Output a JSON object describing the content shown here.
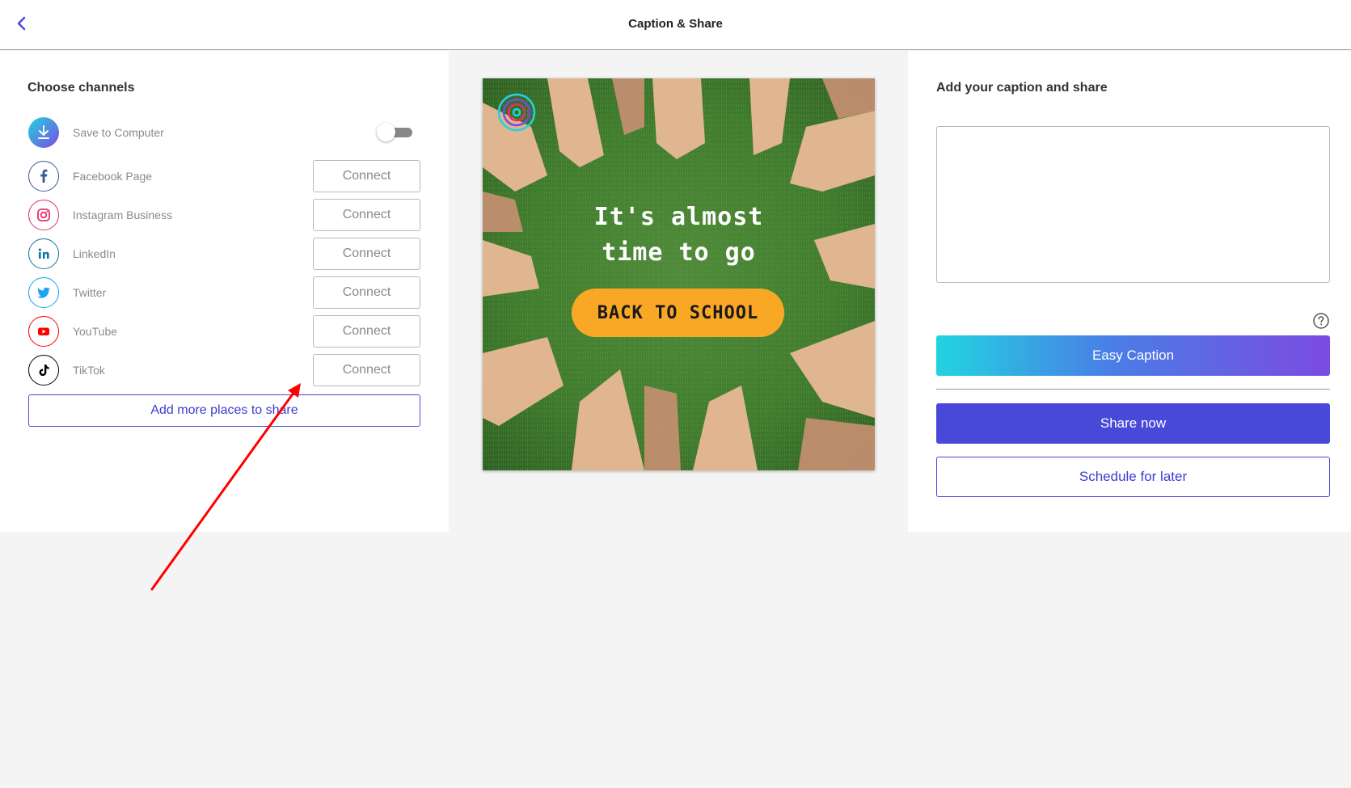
{
  "header": {
    "title": "Caption & Share",
    "back_icon": "chevron-left-icon"
  },
  "channels": {
    "title": "Choose channels",
    "items": [
      {
        "label": "Save to Computer",
        "icon": "download-icon",
        "action": "toggle"
      },
      {
        "label": "Facebook Page",
        "icon": "facebook-icon",
        "action_label": "Connect",
        "color": "#3b5998"
      },
      {
        "label": "Instagram Business",
        "icon": "instagram-icon",
        "action_label": "Connect",
        "color": "#e1306c"
      },
      {
        "label": "LinkedIn",
        "icon": "linkedin-icon",
        "action_label": "Connect",
        "color": "#0e76a8"
      },
      {
        "label": "Twitter",
        "icon": "twitter-icon",
        "action_label": "Connect",
        "color": "#1da1f2"
      },
      {
        "label": "YouTube",
        "icon": "youtube-icon",
        "action_label": "Connect",
        "color": "#ff0000"
      },
      {
        "label": "TikTok",
        "icon": "tiktok-icon",
        "action_label": "Connect",
        "color": "#000000"
      }
    ],
    "add_more_label": "Add more places to share"
  },
  "preview": {
    "headline": "It's almost\ntime to go",
    "pill_text": "BACK TO SCHOOL"
  },
  "caption": {
    "title": "Add your caption and share",
    "value": "",
    "easy_caption_label": "Easy Caption",
    "share_now_label": "Share now",
    "schedule_label": "Schedule for later"
  },
  "colors": {
    "accent": "#4949d9",
    "pill": "#f9a825",
    "annotation": "#ff0000"
  }
}
